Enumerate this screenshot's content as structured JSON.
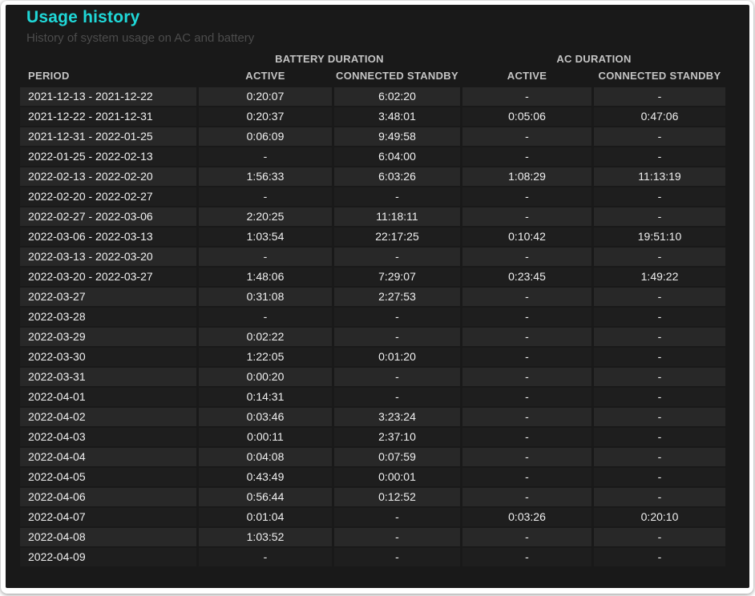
{
  "page": {
    "title": "Usage history",
    "subtitle": "History of system usage on AC and battery"
  },
  "colors": {
    "accent_title": "#1fd8d8",
    "page_background": "#191919",
    "row_light": "#282828",
    "row_dark": "#1e1e1e",
    "header_text": "#c4c4c4",
    "cell_text": "#f0f0f0",
    "subtitle_text": "#4c4c4c"
  },
  "table": {
    "group_headers": [
      {
        "label": "BATTERY DURATION"
      },
      {
        "label": "AC DURATION"
      }
    ],
    "column_headers": [
      "PERIOD",
      "ACTIVE",
      "CONNECTED STANDBY",
      "ACTIVE",
      "CONNECTED STANDBY"
    ],
    "rows": [
      {
        "period": "2021-12-13 - 2021-12-22",
        "battery_active": "0:20:07",
        "battery_connected_standby": "6:02:20",
        "ac_active": "-",
        "ac_connected_standby": "-"
      },
      {
        "period": "2021-12-22 - 2021-12-31",
        "battery_active": "0:20:37",
        "battery_connected_standby": "3:48:01",
        "ac_active": "0:05:06",
        "ac_connected_standby": "0:47:06"
      },
      {
        "period": "2021-12-31 - 2022-01-25",
        "battery_active": "0:06:09",
        "battery_connected_standby": "9:49:58",
        "ac_active": "-",
        "ac_connected_standby": "-"
      },
      {
        "period": "2022-01-25 - 2022-02-13",
        "battery_active": "-",
        "battery_connected_standby": "6:04:00",
        "ac_active": "-",
        "ac_connected_standby": "-"
      },
      {
        "period": "2022-02-13 - 2022-02-20",
        "battery_active": "1:56:33",
        "battery_connected_standby": "6:03:26",
        "ac_active": "1:08:29",
        "ac_connected_standby": "11:13:19"
      },
      {
        "period": "2022-02-20 - 2022-02-27",
        "battery_active": "-",
        "battery_connected_standby": "-",
        "ac_active": "-",
        "ac_connected_standby": "-"
      },
      {
        "period": "2022-02-27 - 2022-03-06",
        "battery_active": "2:20:25",
        "battery_connected_standby": "11:18:11",
        "ac_active": "-",
        "ac_connected_standby": "-"
      },
      {
        "period": "2022-03-06 - 2022-03-13",
        "battery_active": "1:03:54",
        "battery_connected_standby": "22:17:25",
        "ac_active": "0:10:42",
        "ac_connected_standby": "19:51:10"
      },
      {
        "period": "2022-03-13 - 2022-03-20",
        "battery_active": "-",
        "battery_connected_standby": "-",
        "ac_active": "-",
        "ac_connected_standby": "-"
      },
      {
        "period": "2022-03-20 - 2022-03-27",
        "battery_active": "1:48:06",
        "battery_connected_standby": "7:29:07",
        "ac_active": "0:23:45",
        "ac_connected_standby": "1:49:22"
      },
      {
        "period": "2022-03-27",
        "battery_active": "0:31:08",
        "battery_connected_standby": "2:27:53",
        "ac_active": "-",
        "ac_connected_standby": "-"
      },
      {
        "period": "2022-03-28",
        "battery_active": "-",
        "battery_connected_standby": "-",
        "ac_active": "-",
        "ac_connected_standby": "-"
      },
      {
        "period": "2022-03-29",
        "battery_active": "0:02:22",
        "battery_connected_standby": "-",
        "ac_active": "-",
        "ac_connected_standby": "-"
      },
      {
        "period": "2022-03-30",
        "battery_active": "1:22:05",
        "battery_connected_standby": "0:01:20",
        "ac_active": "-",
        "ac_connected_standby": "-"
      },
      {
        "period": "2022-03-31",
        "battery_active": "0:00:20",
        "battery_connected_standby": "-",
        "ac_active": "-",
        "ac_connected_standby": "-"
      },
      {
        "period": "2022-04-01",
        "battery_active": "0:14:31",
        "battery_connected_standby": "-",
        "ac_active": "-",
        "ac_connected_standby": "-"
      },
      {
        "period": "2022-04-02",
        "battery_active": "0:03:46",
        "battery_connected_standby": "3:23:24",
        "ac_active": "-",
        "ac_connected_standby": "-"
      },
      {
        "period": "2022-04-03",
        "battery_active": "0:00:11",
        "battery_connected_standby": "2:37:10",
        "ac_active": "-",
        "ac_connected_standby": "-"
      },
      {
        "period": "2022-04-04",
        "battery_active": "0:04:08",
        "battery_connected_standby": "0:07:59",
        "ac_active": "-",
        "ac_connected_standby": "-"
      },
      {
        "period": "2022-04-05",
        "battery_active": "0:43:49",
        "battery_connected_standby": "0:00:01",
        "ac_active": "-",
        "ac_connected_standby": "-"
      },
      {
        "period": "2022-04-06",
        "battery_active": "0:56:44",
        "battery_connected_standby": "0:12:52",
        "ac_active": "-",
        "ac_connected_standby": "-"
      },
      {
        "period": "2022-04-07",
        "battery_active": "0:01:04",
        "battery_connected_standby": "-",
        "ac_active": "0:03:26",
        "ac_connected_standby": "0:20:10"
      },
      {
        "period": "2022-04-08",
        "battery_active": "1:03:52",
        "battery_connected_standby": "-",
        "ac_active": "-",
        "ac_connected_standby": "-"
      },
      {
        "period": "2022-04-09",
        "battery_active": "-",
        "battery_connected_standby": "-",
        "ac_active": "-",
        "ac_connected_standby": "-"
      }
    ]
  }
}
